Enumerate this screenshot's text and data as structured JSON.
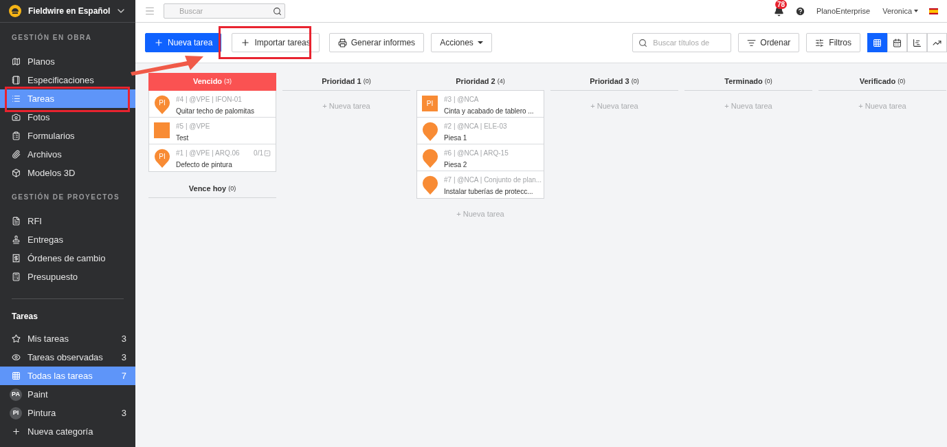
{
  "sidebar": {
    "project": "Fieldwire en Español",
    "sections": [
      {
        "heading": "GESTIÓN EN OBRA",
        "items": [
          {
            "label": "Planos",
            "selected": false
          },
          {
            "label": "Especificaciones",
            "selected": false
          },
          {
            "label": "Tareas",
            "selected": true
          },
          {
            "label": "Fotos",
            "selected": false
          },
          {
            "label": "Formularios",
            "selected": false
          },
          {
            "label": "Archivos",
            "selected": false
          },
          {
            "label": "Modelos 3D",
            "selected": false
          }
        ]
      },
      {
        "heading": "GESTIÓN DE PROYECTOS",
        "items": [
          {
            "label": "RFI",
            "selected": false
          },
          {
            "label": "Entregas",
            "selected": false
          },
          {
            "label": "Órdenes de cambio",
            "selected": false
          },
          {
            "label": "Presupuesto",
            "selected": false
          }
        ]
      }
    ],
    "tasks_heading": "Tareas",
    "task_items": [
      {
        "label": "Mis tareas",
        "count": "3",
        "selected": false
      },
      {
        "label": "Tareas observadas",
        "count": "3",
        "selected": false
      },
      {
        "label": "Todas las tareas",
        "count": "7",
        "selected": true
      },
      {
        "avatar": "PA",
        "label": "Paint",
        "selected": false
      },
      {
        "avatar": "PI",
        "label": "Pintura",
        "count": "3",
        "selected": false
      },
      {
        "label": "Nueva categoría",
        "selected": false
      }
    ]
  },
  "topbar": {
    "search_placeholder": "Buscar",
    "notifications": "78",
    "organization": "PlanoEnterprise",
    "user": "Veronica"
  },
  "toolbar": {
    "buttons": [
      {
        "kind": "primary",
        "label": "Nueva tarea"
      },
      {
        "kind": "plus",
        "label": "Importar tareas"
      },
      {
        "kind": "print",
        "label": "Generar informes"
      },
      {
        "kind": "dropdown",
        "label": "Acciones"
      }
    ],
    "search_placeholder": "Buscar títulos de",
    "sort": "Ordenar",
    "filter": "Filtros",
    "views": [
      {
        "kind": "grid",
        "selected": true
      },
      {
        "kind": "calendar",
        "selected": false
      },
      {
        "kind": "gantt",
        "selected": false
      },
      {
        "kind": "chart",
        "selected": false
      }
    ]
  },
  "board": {
    "columns": [
      {
        "sections": [
          {
            "title": "Vencido",
            "count": "(3)",
            "highlighted": true,
            "tasks": [
              {
                "kind": "pin",
                "marker_label": "PI",
                "meta": "#4 | @VPE | IFON-01",
                "title": "Quitar techo de palomitas"
              },
              {
                "kind": "square",
                "meta": "#5 | @VPE",
                "title": "Test"
              },
              {
                "kind": "pin",
                "marker_label": "PI",
                "meta": "#1 | @VPE | ARQ.06",
                "title": "Defecto de pintura",
                "checklist": "0/1"
              }
            ]
          },
          {
            "title": "Vence hoy",
            "count": "(0)",
            "highlighted": false
          }
        ]
      },
      {
        "sections": [
          {
            "title": "Prioridad 1",
            "count": "(0)",
            "highlighted": false,
            "add": "+ Nueva tarea"
          }
        ]
      },
      {
        "sections": [
          {
            "title": "Prioridad 2",
            "count": "(4)",
            "highlighted": false,
            "tasks": [
              {
                "kind": "square",
                "marker_label": "PI",
                "meta": "#3 | @NCA",
                "title": "Cinta y acabado de tablero ..."
              },
              {
                "kind": "pin",
                "meta": "#2 | @NCA | ELE-03",
                "title": "Piesa 1"
              },
              {
                "kind": "pin",
                "meta": "#6 | @NCA | ARQ-15",
                "title": "Piesa 2"
              },
              {
                "kind": "pin",
                "meta": "#7 | @NCA | Conjunto de plan...",
                "title": "Instalar tuberías de protecc..."
              }
            ],
            "add": "+ Nueva tarea"
          }
        ]
      },
      {
        "sections": [
          {
            "title": "Prioridad 3",
            "count": "(0)",
            "highlighted": false,
            "add": "+ Nueva tarea"
          }
        ]
      },
      {
        "sections": [
          {
            "title": "Terminado",
            "count": "(0)",
            "highlighted": false,
            "add": "+ Nueva tarea"
          }
        ]
      },
      {
        "sections": [
          {
            "title": "Verificado",
            "count": "(0)",
            "highlighted": false,
            "add": "+ Nueva tarea"
          }
        ]
      }
    ]
  }
}
